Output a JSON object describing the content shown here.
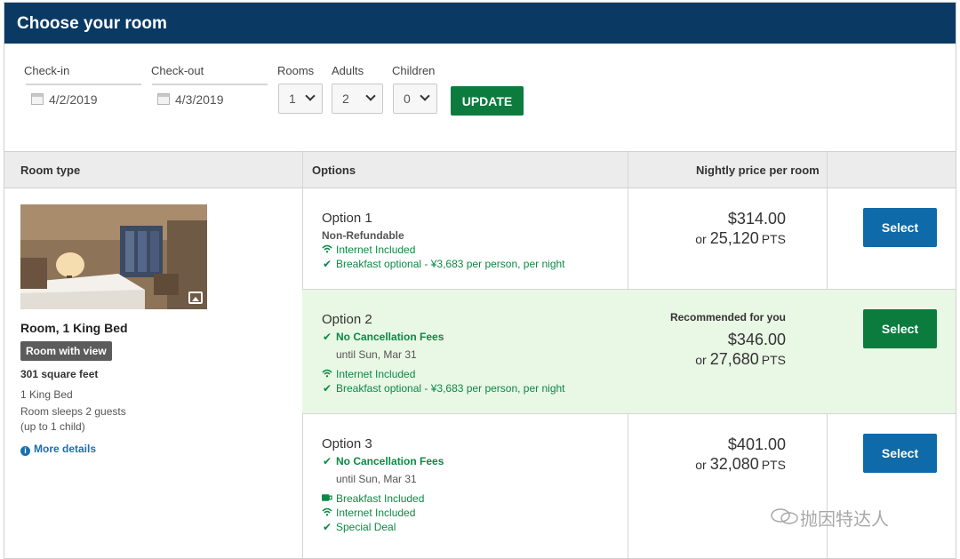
{
  "header": {
    "title": "Choose your room"
  },
  "search": {
    "checkin_label": "Check-in",
    "checkin_value": "4/2/2019",
    "checkout_label": "Check-out",
    "checkout_value": "4/3/2019",
    "rooms_label": "Rooms",
    "rooms_value": "1",
    "adults_label": "Adults",
    "adults_value": "2",
    "children_label": "Children",
    "children_value": "0",
    "update_label": "UPDATE"
  },
  "table": {
    "col_room_type": "Room type",
    "col_options": "Options",
    "col_price": "Nightly price per room"
  },
  "room": {
    "name": "Room, 1 King Bed",
    "badge": "Room with view",
    "sqft": "301 square feet",
    "bed": "1 King Bed",
    "sleeps": "Room sleeps 2 guests",
    "sleeps_note": "(up to 1 child)",
    "more_details": "More details"
  },
  "options": [
    {
      "title": "Option 1",
      "subtitle": "Non-Refundable",
      "wifi": "Internet Included",
      "breakfast": "Breakfast optional - ¥3,683 per person, per night",
      "price": "$314.00",
      "or": "or",
      "points": "25,120",
      "points_unit": "PTS",
      "select_label": "Select"
    },
    {
      "title": "Option 2",
      "cancellation": "No Cancellation Fees",
      "until": "until Sun, Mar 31",
      "wifi": "Internet Included",
      "breakfast": "Breakfast optional - ¥3,683 per person, per night",
      "recommended": "Recommended for you",
      "price": "$346.00",
      "or": "or",
      "points": "27,680",
      "points_unit": "PTS",
      "select_label": "Select"
    },
    {
      "title": "Option 3",
      "cancellation": "No Cancellation Fees",
      "until": "until Sun, Mar 31",
      "breakfast": "Breakfast Included",
      "wifi": "Internet Included",
      "deal": "Special Deal",
      "price": "$401.00",
      "or": "or",
      "points": "32,080",
      "points_unit": "PTS",
      "select_label": "Select"
    }
  ],
  "icons": {
    "check": "✔",
    "wifi": "wifi-icon",
    "cup": "coffee-cup-icon",
    "calendar": "calendar-icon",
    "info": "i"
  },
  "colors": {
    "header_bg": "#0a3a63",
    "green": "#0b7c3e",
    "blue": "#0e6aa8",
    "feature_green": "#0b8a45",
    "recommended_bg": "#e9f7e5"
  },
  "watermark": {
    "text": "抛因特达人"
  }
}
